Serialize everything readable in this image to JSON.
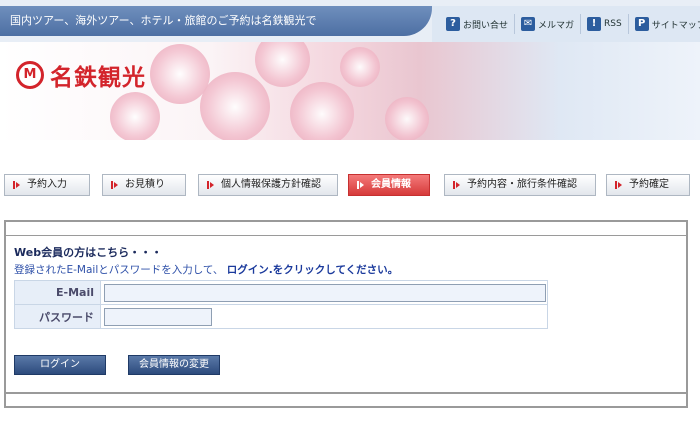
{
  "header": {
    "tagline": "国内ツアー、海外ツアー、ホテル・旅館のご予約は名鉄観光で",
    "utility_links": [
      {
        "icon": "question-icon",
        "glyph": "?",
        "label": "お問い合せ"
      },
      {
        "icon": "mail-icon",
        "glyph": "✉",
        "label": "メルマガ"
      },
      {
        "icon": "rss-icon",
        "glyph": "!",
        "label": "RSS"
      },
      {
        "icon": "sitemap-icon",
        "glyph": "P",
        "label": "サイトマップ"
      }
    ]
  },
  "brand": {
    "logo_mark": "M",
    "logo_text": "名鉄観光",
    "color": "#d3242b"
  },
  "steps": [
    {
      "label": "予約入力",
      "active": false
    },
    {
      "label": "お見積り",
      "active": false
    },
    {
      "label": "個人情報保護方針確認",
      "active": false
    },
    {
      "label": "会員情報",
      "active": true
    },
    {
      "label": "予約内容・旅行条件確認",
      "active": false
    },
    {
      "label": "予約確定",
      "active": false
    }
  ],
  "login": {
    "heading": "Web会員の方はこちら・・・",
    "instruction_prefix": "登録されたE-Mailとパスワードを入力して、",
    "instruction_emphasis": "ログイン.をクリックしてください。",
    "email_label": "E-Mail",
    "email_value": "",
    "password_label": "パスワード",
    "password_value": "",
    "login_button": "ログイン",
    "member_button": "会員情報の変更"
  }
}
